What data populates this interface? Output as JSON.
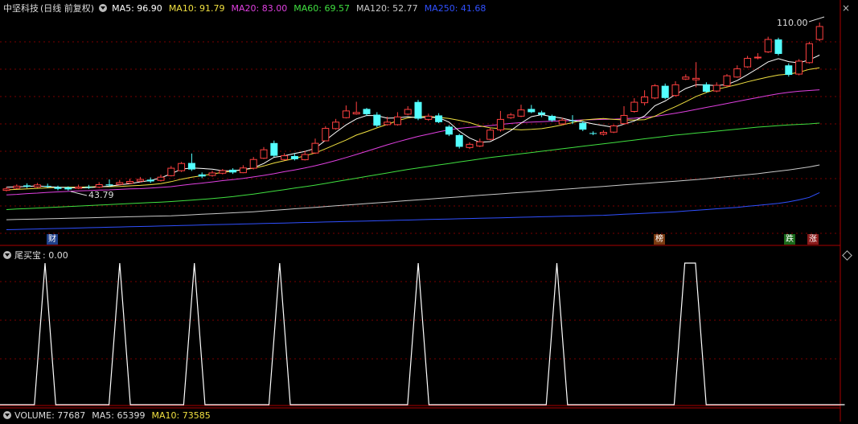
{
  "header": {
    "stock_name": "中坚科技",
    "period": "(日线 前复权)",
    "ma": [
      {
        "label": "MA5: 96.90",
        "color": "#ffffff"
      },
      {
        "label": "MA10: 91.79",
        "color": "#f0e040"
      },
      {
        "label": "MA20: 83.00",
        "color": "#e040e0"
      },
      {
        "label": "MA60: 69.57",
        "color": "#40e040"
      },
      {
        "label": "MA120: 52.77",
        "color": "#c8c8c8"
      },
      {
        "label": "MA250: 41.68",
        "color": "#3050ff"
      }
    ]
  },
  "price_annotations": {
    "high": "110.00",
    "low": "43.79"
  },
  "event_badges": [
    {
      "label": "财",
      "color": "#4a7fd8"
    },
    {
      "label": "榜",
      "color": "#c87830"
    },
    {
      "label": "跌",
      "color": "#30a030"
    },
    {
      "label": "涨",
      "color": "#d03030"
    }
  ],
  "indicator": {
    "name": "尾买宝",
    "value": ": 0.00"
  },
  "volume": {
    "label": "VOLUME: 77687",
    "ma5": "MA5: 65399",
    "ma10": "MA10: 73585"
  },
  "colors": {
    "up": "#ff4040",
    "down": "#54ffff",
    "grid": "#7a0000",
    "axis": "#aa0000"
  },
  "chart_data": {
    "type": "candlestick",
    "candles": [
      [
        42.6,
        43.2,
        44.0,
        42.2
      ],
      [
        43.5,
        44.3,
        45.0,
        43.1
      ],
      [
        44.6,
        44.1,
        45.4,
        43.5
      ],
      [
        44.0,
        44.8,
        45.6,
        43.6
      ],
      [
        44.4,
        44.1,
        45.3,
        43.5
      ],
      [
        43.9,
        43.2,
        44.5,
        42.6
      ],
      [
        43.8,
        43.0,
        44.2,
        42.5
      ],
      [
        43.4,
        43.9,
        44.9,
        43.1
      ],
      [
        44.0,
        43.8,
        44.8,
        43.2
      ],
      [
        43.9,
        44.9,
        45.9,
        43.5
      ],
      [
        45.0,
        44.6,
        47.0,
        44.1
      ],
      [
        45.0,
        45.7,
        46.8,
        44.8
      ],
      [
        45.5,
        46.2,
        47.3,
        45.2
      ],
      [
        46.3,
        47.0,
        48.0,
        45.9
      ],
      [
        46.9,
        46.2,
        47.8,
        45.6
      ],
      [
        46.6,
        47.9,
        48.9,
        46.2
      ],
      [
        48.5,
        51.5,
        52.4,
        48.2
      ],
      [
        50.5,
        53.4,
        54.0,
        50.0
      ],
      [
        53.6,
        51.0,
        57.4,
        50.4
      ],
      [
        49.0,
        48.2,
        49.8,
        47.5
      ],
      [
        48.6,
        49.6,
        50.5,
        48.1
      ],
      [
        49.5,
        50.5,
        51.2,
        49.0
      ],
      [
        50.9,
        49.8,
        51.5,
        49.2
      ],
      [
        49.7,
        51.6,
        52.7,
        49.5
      ],
      [
        51.5,
        55.0,
        56.0,
        51.0
      ],
      [
        55.5,
        58.9,
        60.0,
        55.2
      ],
      [
        61.6,
        56.5,
        62.6,
        56.0
      ],
      [
        55.0,
        56.5,
        57.5,
        54.6
      ],
      [
        56.4,
        55.1,
        57.4,
        54.6
      ],
      [
        54.9,
        57.0,
        58.5,
        54.6
      ],
      [
        57.6,
        61.5,
        63.4,
        57.2
      ],
      [
        62.5,
        67.5,
        68.4,
        62.3
      ],
      [
        67.4,
        70.0,
        71.3,
        67.0
      ],
      [
        71.8,
        74.5,
        76.7,
        71.5
      ],
      [
        73.3,
        73.9,
        78.2,
        73.0
      ],
      [
        75.3,
        73.2,
        75.7,
        72.5
      ],
      [
        73.0,
        68.6,
        74.0,
        68.0
      ],
      [
        69.0,
        70.0,
        72.2,
        68.6
      ],
      [
        69.0,
        72.1,
        74.0,
        68.6
      ],
      [
        73.2,
        75.1,
        76.4,
        72.8
      ],
      [
        78.1,
        71.4,
        78.9,
        70.8
      ],
      [
        71.1,
        72.4,
        73.4,
        70.5
      ],
      [
        72.7,
        70.0,
        73.6,
        69.6
      ],
      [
        68.2,
        65.0,
        68.8,
        64.4
      ],
      [
        64.8,
        60.1,
        65.3,
        59.4
      ],
      [
        59.8,
        61.1,
        61.9,
        59.2
      ],
      [
        60.4,
        62.1,
        63.4,
        60.0
      ],
      [
        63.1,
        66.8,
        67.6,
        62.7
      ],
      [
        66.9,
        71.1,
        74.5,
        66.2
      ],
      [
        71.8,
        72.9,
        73.7,
        71.3
      ],
      [
        72.4,
        74.9,
        77.0,
        72.0
      ],
      [
        75.3,
        74.0,
        76.9,
        73.6
      ],
      [
        73.9,
        73.0,
        74.6,
        72.0
      ],
      [
        72.5,
        70.7,
        73.0,
        70.1
      ],
      [
        69.3,
        70.8,
        71.8,
        68.8
      ],
      [
        70.7,
        70.6,
        72.8,
        69.2
      ],
      [
        69.7,
        67.0,
        70.4,
        66.4
      ],
      [
        65.6,
        65.3,
        66.3,
        64.8
      ],
      [
        65.2,
        65.9,
        66.7,
        64.6
      ],
      [
        66.0,
        68.5,
        69.0,
        65.6
      ],
      [
        69.4,
        72.7,
        76.4,
        69.0
      ],
      [
        74.3,
        78.0,
        79.6,
        73.8
      ],
      [
        77.8,
        80.1,
        82.8,
        76.7
      ],
      [
        79.7,
        84.6,
        85.3,
        79.2
      ],
      [
        84.6,
        79.7,
        85.5,
        79.2
      ],
      [
        80.7,
        85.0,
        86.4,
        80.3
      ],
      [
        87.3,
        88.1,
        89.2,
        86.9
      ],
      [
        87.0,
        87.6,
        94.1,
        84.0
      ],
      [
        85.2,
        82.2,
        86.0,
        81.8
      ],
      [
        82.5,
        84.8,
        86.0,
        82.0
      ],
      [
        84.6,
        88.6,
        89.3,
        84.2
      ],
      [
        88.1,
        91.4,
        92.8,
        87.8
      ],
      [
        92.2,
        95.6,
        96.6,
        91.8
      ],
      [
        96.0,
        96.1,
        97.7,
        95.2
      ],
      [
        98.2,
        103.2,
        104.3,
        97.8
      ],
      [
        103.2,
        97.4,
        103.9,
        96.8
      ],
      [
        92.8,
        89.0,
        93.6,
        88.3
      ],
      [
        89.3,
        94.5,
        95.3,
        88.8
      ],
      [
        93.9,
        101.5,
        102.3,
        93.5
      ],
      [
        103.2,
        108.4,
        110.0,
        102.5
      ]
    ],
    "ma5": [
      43.9,
      44.0,
      44.2,
      44.4,
      44.1,
      43.9,
      43.7,
      43.6,
      43.7,
      44.0,
      44.3,
      44.8,
      45.3,
      46.0,
      46.6,
      47.6,
      49.3,
      51.1,
      51.6,
      51.4,
      51.1,
      50.5,
      50.5,
      50.9,
      51.7,
      53.4,
      55.9,
      56.5,
      57.4,
      58.2,
      59.5,
      62.7,
      65.9,
      68.9,
      71.3,
      72.7,
      72.6,
      71.6,
      71.7,
      72.2,
      71.7,
      72.0,
      71.8,
      70.0,
      66.4,
      63.6,
      61.9,
      62.2,
      64.2,
      66.6,
      69.6,
      72.2,
      73.0,
      72.2,
      71.6,
      70.6,
      70.2,
      69.3,
      68.6,
      67.9,
      69.2,
      70.5,
      72.5,
      76.6,
      78.5,
      81.1,
      83.5,
      85.0,
      84.9,
      84.7,
      85.1,
      86.7,
      89.1,
      91.6,
      94.2,
      95.5,
      94.3,
      93.8,
      95.0,
      96.9
    ],
    "ma10": [
      42.8,
      43.0,
      43.2,
      43.4,
      43.6,
      43.8,
      43.9,
      43.9,
      44.0,
      44.1,
      44.1,
      44.2,
      44.4,
      44.6,
      44.9,
      45.3,
      46.1,
      47.1,
      47.9,
      48.5,
      49.2,
      49.8,
      50.3,
      50.9,
      51.5,
      52.4,
      53.6,
      54.5,
      55.4,
      56.5,
      57.6,
      59.3,
      61.1,
      62.8,
      64.8,
      66.2,
      67.7,
      69.1,
      70.6,
      71.7,
      72.2,
      72.3,
      71.9,
      71.5,
      70.7,
      69.8,
      68.5,
      67.7,
      67.4,
      67.2,
      66.9,
      67.1,
      67.4,
      68.1,
      68.9,
      69.8,
      70.8,
      71.2,
      71.5,
      71.1,
      70.9,
      70.8,
      71.0,
      72.4,
      74.4,
      76.2,
      78.2,
      80.3,
      81.9,
      83.2,
      84.1,
      85.1,
      86.2,
      87.2,
      88.1,
      88.9,
      89.3,
      90.0,
      91.2,
      91.8
    ],
    "ma20": [
      40.8,
      41.0,
      41.3,
      41.5,
      41.8,
      42.0,
      42.2,
      42.4,
      42.5,
      42.7,
      42.8,
      43.0,
      43.2,
      43.3,
      43.5,
      43.8,
      44.1,
      44.6,
      45.1,
      45.5,
      46.0,
      46.5,
      46.9,
      47.4,
      48.0,
      48.6,
      49.3,
      50.1,
      50.8,
      51.6,
      52.5,
      53.5,
      54.6,
      55.8,
      57.0,
      58.3,
      59.6,
      60.9,
      62.1,
      63.2,
      64.3,
      65.2,
      66.1,
      66.9,
      67.5,
      67.9,
      68.2,
      68.6,
      69.1,
      69.5,
      69.8,
      70.0,
      70.2,
      70.4,
      70.5,
      70.7,
      70.9,
      71.0,
      71.1,
      71.2,
      71.4,
      71.6,
      71.9,
      72.3,
      72.9,
      73.6,
      74.3,
      75.1,
      75.9,
      76.7,
      77.5,
      78.3,
      79.1,
      79.9,
      80.7,
      81.4,
      82.0,
      82.4,
      82.7,
      83.0
    ],
    "ma60": [
      34.9,
      35.1,
      35.3,
      35.5,
      35.7,
      35.9,
      36.1,
      36.3,
      36.5,
      36.7,
      36.9,
      37.1,
      37.3,
      37.5,
      37.7,
      37.9,
      38.1,
      38.4,
      38.7,
      39.0,
      39.3,
      39.7,
      40.1,
      40.6,
      41.1,
      41.7,
      42.3,
      42.9,
      43.5,
      44.1,
      44.7,
      45.4,
      46.1,
      46.8,
      47.5,
      48.2,
      48.9,
      49.6,
      50.3,
      51.0,
      51.6,
      52.2,
      52.8,
      53.4,
      54.0,
      54.6,
      55.2,
      55.8,
      56.3,
      56.8,
      57.3,
      57.8,
      58.3,
      58.8,
      59.3,
      59.8,
      60.3,
      60.8,
      61.3,
      61.8,
      62.3,
      62.8,
      63.3,
      63.8,
      64.3,
      64.8,
      65.2,
      65.6,
      66.0,
      66.4,
      66.8,
      67.2,
      67.6,
      68.0,
      68.3,
      68.6,
      68.9,
      69.1,
      69.3,
      69.6
    ],
    "ma120": [
      30.8,
      30.9,
      31.0,
      31.1,
      31.2,
      31.3,
      31.4,
      31.5,
      31.6,
      31.7,
      31.8,
      31.9,
      32.0,
      32.1,
      32.2,
      32.3,
      32.4,
      32.6,
      32.8,
      33.0,
      33.2,
      33.4,
      33.6,
      33.8,
      34.0,
      34.3,
      34.6,
      34.9,
      35.2,
      35.5,
      35.8,
      36.1,
      36.4,
      36.7,
      37.0,
      37.3,
      37.6,
      37.9,
      38.2,
      38.5,
      38.8,
      39.1,
      39.4,
      39.7,
      40.0,
      40.3,
      40.6,
      40.9,
      41.2,
      41.5,
      41.8,
      42.1,
      42.4,
      42.7,
      43.0,
      43.3,
      43.6,
      43.9,
      44.2,
      44.5,
      44.8,
      45.1,
      45.4,
      45.7,
      46.0,
      46.3,
      46.6,
      46.9,
      47.3,
      47.7,
      48.1,
      48.5,
      48.9,
      49.3,
      49.8,
      50.3,
      50.8,
      51.4,
      52.0,
      52.8
    ],
    "ma250": [
      26.8,
      26.9,
      27.0,
      27.1,
      27.2,
      27.3,
      27.4,
      27.5,
      27.6,
      27.7,
      27.8,
      27.9,
      28.0,
      28.1,
      28.2,
      28.3,
      28.4,
      28.5,
      28.6,
      28.7,
      28.8,
      28.9,
      29.0,
      29.1,
      29.2,
      29.3,
      29.4,
      29.5,
      29.6,
      29.7,
      29.8,
      29.9,
      30.0,
      30.1,
      30.2,
      30.3,
      30.4,
      30.5,
      30.6,
      30.7,
      30.8,
      30.9,
      31.0,
      31.1,
      31.2,
      31.3,
      31.4,
      31.5,
      31.6,
      31.7,
      31.8,
      31.9,
      32.0,
      32.1,
      32.2,
      32.3,
      32.4,
      32.5,
      32.6,
      32.8,
      33.0,
      33.2,
      33.4,
      33.6,
      33.8,
      34.0,
      34.3,
      34.6,
      34.9,
      35.2,
      35.5,
      35.8,
      36.2,
      36.6,
      37.0,
      37.4,
      38.0,
      38.8,
      39.8,
      41.7
    ],
    "indicator_signal": [
      0,
      0,
      0,
      0,
      1,
      0,
      0,
      0,
      0,
      0,
      0,
      1,
      0,
      0,
      0,
      0,
      0,
      0,
      1,
      0,
      0,
      0,
      0,
      0,
      0,
      0,
      1,
      0,
      0,
      0,
      0,
      0,
      0,
      0,
      0,
      0,
      0,
      0,
      0,
      1,
      0,
      0,
      0,
      0,
      0,
      0,
      0,
      0,
      0,
      0,
      0,
      0,
      1,
      0,
      0,
      0,
      0,
      0,
      0,
      0,
      0,
      0,
      0,
      0,
      1,
      1,
      0,
      0,
      0,
      0,
      0,
      0,
      0,
      0,
      0,
      0,
      0,
      0,
      0,
      0
    ],
    "indicator_range": [
      0,
      1
    ]
  }
}
